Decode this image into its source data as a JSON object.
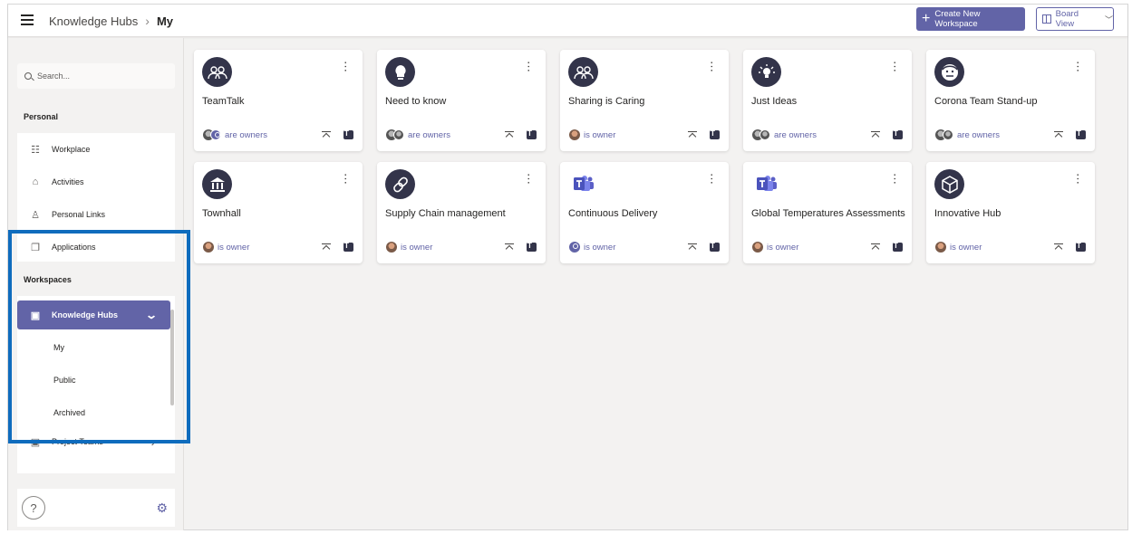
{
  "header": {
    "breadcrumb_root": "Knowledge Hubs",
    "breadcrumb_sep": ">",
    "breadcrumb_current": "My",
    "create_button": "Create New Workspace",
    "view_button": "Board View"
  },
  "sidebar": {
    "search_placeholder": "Search...",
    "personal_label": "Personal",
    "personal_items": [
      {
        "label": "Workplace",
        "icon": "list-icon"
      },
      {
        "label": "Activities",
        "icon": "home-icon"
      },
      {
        "label": "Personal Links",
        "icon": "person-icon"
      },
      {
        "label": "Applications",
        "icon": "copy-icon"
      }
    ],
    "workspaces_label": "Workspaces",
    "active_workspace": "Knowledge Hubs",
    "sub_items": [
      "My",
      "Public",
      "Archived"
    ],
    "next_workspace": "Project Teams",
    "help": "?"
  },
  "cards": [
    {
      "title": "TeamTalk",
      "owner": "are owners",
      "icon": "group-icon"
    },
    {
      "title": "Need to know",
      "owner": "are owners",
      "icon": "lightbulb-head-icon"
    },
    {
      "title": "Sharing is Caring",
      "owner": "is owner",
      "icon": "group-icon"
    },
    {
      "title": "Just Ideas",
      "owner": "are owners",
      "icon": "lightbulb-icon"
    },
    {
      "title": "Corona Team Stand-up",
      "owner": "are owners",
      "icon": "face-icon"
    },
    {
      "title": "Townhall",
      "owner": "is owner",
      "icon": "building-icon"
    },
    {
      "title": "Supply Chain management",
      "owner": "is owner",
      "icon": "link-icon"
    },
    {
      "title": "Continuous Delivery",
      "owner": "is owner",
      "icon": "teams-icon"
    },
    {
      "title": "Global Temperatures Assessments",
      "owner": "is owner",
      "icon": "teams-icon"
    },
    {
      "title": "Innovative Hub",
      "owner": "is owner",
      "icon": "cube-icon"
    }
  ],
  "colors": {
    "accent": "#6264a7",
    "highlight": "#0f6cbd",
    "avatar_bg": "#33344a"
  }
}
